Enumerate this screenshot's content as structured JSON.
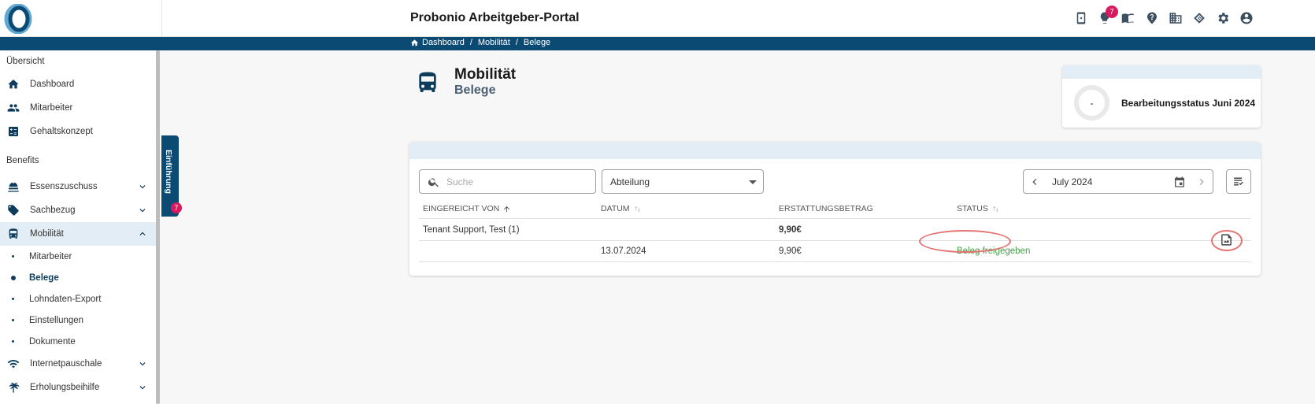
{
  "header": {
    "app_title": "Probonio Arbeitgeber-Portal",
    "notification_count": "7",
    "icons": [
      "phone-icon",
      "lightbulb-icon",
      "book-icon",
      "help-icon",
      "building-icon",
      "handshake-icon",
      "gear-icon",
      "account-icon"
    ]
  },
  "breadcrumb": [
    "Dashboard",
    "Mobilität",
    "Belege"
  ],
  "sidebar": {
    "section_overview": "Übersicht",
    "section_benefits": "Benefits",
    "items": [
      {
        "label": "Dashboard",
        "icon": "home-icon"
      },
      {
        "label": "Mitarbeiter",
        "icon": "people-icon"
      },
      {
        "label": "Gehaltskonzept",
        "icon": "calculator-icon"
      }
    ],
    "benefits": [
      {
        "label": "Essenszuschuss",
        "icon": "food-icon"
      },
      {
        "label": "Sachbezug",
        "icon": "tag-icon"
      },
      {
        "label": "Mobilität",
        "icon": "bus-icon"
      }
    ],
    "mobility_sub": [
      "Mitarbeiter",
      "Belege",
      "Lohndaten-Export",
      "Einstellungen",
      "Dokumente"
    ],
    "more": [
      {
        "label": "Internetpauschale",
        "icon": "wifi-icon"
      },
      {
        "label": "Erholungsbeihilfe",
        "icon": "palm-icon"
      }
    ]
  },
  "intro_tab": {
    "label": "Einführung",
    "badge": "7"
  },
  "page": {
    "title": "Mobilität",
    "subtitle": "Belege"
  },
  "status_card": {
    "value": "-",
    "label": "Bearbeitungsstatus Juni 2024"
  },
  "filters": {
    "search_placeholder": "Suche",
    "department": "Abteilung",
    "month": "July 2024"
  },
  "table": {
    "columns": [
      "EINGEREICHT VON",
      "DATUM",
      "ERSTATTUNGSBETRAG",
      "STATUS"
    ],
    "group_row": {
      "name": "Tenant Support, Test (1)",
      "amount": "9,90€"
    },
    "detail_row": {
      "date": "13.07.2024",
      "amount": "9,90€",
      "status": "Beleg freigegeben"
    }
  },
  "colors": {
    "brand": "#0b4a73",
    "status_ok": "#43a047",
    "badge": "#d81b60",
    "annotation": "#e57373"
  }
}
